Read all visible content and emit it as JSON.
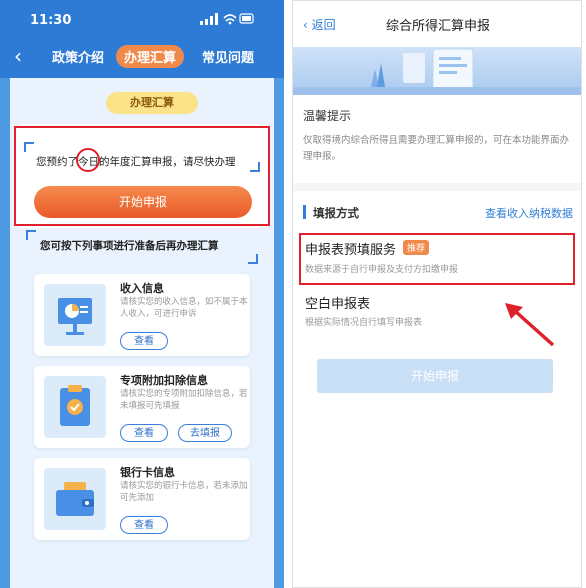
{
  "left": {
    "status_time": "11:30",
    "nav": {
      "tab1": "政策介绍",
      "tab2": "办理汇算",
      "tab3": "常见问题"
    },
    "ribbon": "办理汇算",
    "notice": "您预约了今日的年度汇算申报，请尽快办理",
    "start_button": "开始申报",
    "prep_title": "您可按下列事项进行准备后再办理汇算",
    "items": [
      {
        "title": "收入信息",
        "desc": "请核实您的收入信息，如不属于本人收入，可进行申诉",
        "btn1": "查看"
      },
      {
        "title": "专项附加扣除信息",
        "desc": "请核实您的专项附加扣除信息，若未填报可先填报",
        "btn1": "查看",
        "btn2": "去填报"
      },
      {
        "title": "银行卡信息",
        "desc": "请核实您的银行卡信息，若未添加可先添加",
        "btn1": "查看"
      }
    ]
  },
  "right": {
    "back": "返回",
    "title": "综合所得汇算申报",
    "tips_title": "温馨提示",
    "tips_text": "仅取得境内综合所得且需要办理汇算申报的，可在本功能界面办理申报。",
    "method_title": "填报方式",
    "method_link": "查看收入纳税数据",
    "option1_title": "申报表预填服务",
    "option1_badge": "推荐",
    "option1_desc": "数据来源于自行申报及支付方扣缴申报",
    "option2_title": "空白申报表",
    "option2_desc": "根据实际情况自行填写申报表",
    "start_button": "开始申报"
  },
  "colors": {
    "brand_blue": "#2e7bd6",
    "accent_orange": "#e95b2a",
    "highlight_red": "#e0202a",
    "link_blue": "#2f7ed8"
  }
}
